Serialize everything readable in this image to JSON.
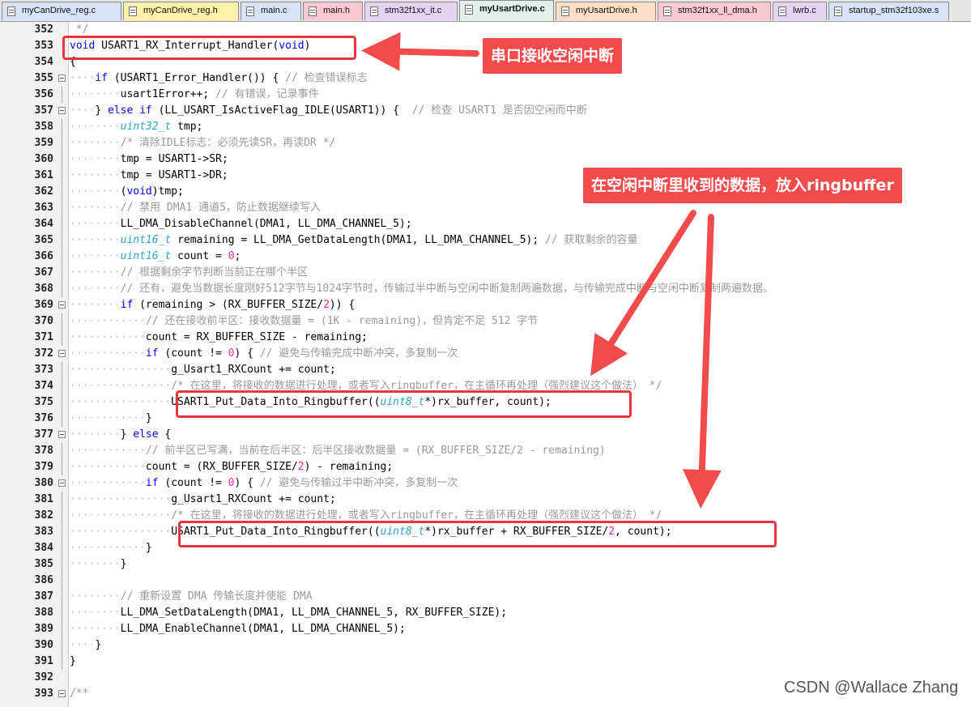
{
  "tabs": [
    {
      "label": "myCanDrive_reg.c",
      "bg": "#d7e2f7",
      "active": false
    },
    {
      "label": "myCanDrive_reg.h",
      "bg": "#fbf1a8",
      "active": false
    },
    {
      "label": "main.c",
      "bg": "#d7e2f7",
      "active": false
    },
    {
      "label": "main.h",
      "bg": "#f8c9d3",
      "active": false
    },
    {
      "label": "stm32f1xx_it.c",
      "bg": "#e2d4f2",
      "active": false
    },
    {
      "label": "myUsartDrive.c",
      "bg": "#d7ecdf",
      "active": true
    },
    {
      "label": "myUsartDrive.h",
      "bg": "#fbdcc5",
      "active": false
    },
    {
      "label": "stm32f1xx_ll_dma.h",
      "bg": "#f8c9d3",
      "active": false
    },
    {
      "label": "lwrb.c",
      "bg": "#e2d4f2",
      "active": false
    },
    {
      "label": "startup_stm32f103xe.s",
      "bg": "#d7e2f7",
      "active": false
    }
  ],
  "code_lines": [
    {
      "num": "352",
      "dots": "",
      "segs": [
        {
          "c": "c",
          "t": " */"
        }
      ]
    },
    {
      "num": "353",
      "dots": "",
      "segs": [
        {
          "c": "k",
          "t": "void"
        },
        {
          "c": "o",
          "t": " USART1_RX_Interrupt_Handler("
        },
        {
          "c": "k",
          "t": "void"
        },
        {
          "c": "o",
          "t": ")"
        }
      ]
    },
    {
      "num": "354",
      "dots": "",
      "segs": [
        {
          "c": "o",
          "t": "{"
        }
      ]
    },
    {
      "num": "355",
      "dots": "····",
      "segs": [
        {
          "c": "k",
          "t": "if"
        },
        {
          "c": "o",
          "t": " (USART1_Error_Handler()) { "
        },
        {
          "c": "c",
          "t": "// 检查错误标志"
        }
      ]
    },
    {
      "num": "356",
      "dots": "········",
      "segs": [
        {
          "c": "o",
          "t": "usart1Error++; "
        },
        {
          "c": "c",
          "t": "// 有错误，记录事件"
        }
      ]
    },
    {
      "num": "357",
      "dots": "····",
      "segs": [
        {
          "c": "o",
          "t": "} "
        },
        {
          "c": "k",
          "t": "else if"
        },
        {
          "c": "o",
          "t": " (LL_USART_IsActiveFlag_IDLE(USART1)) {  "
        },
        {
          "c": "c",
          "t": "// 检查 USART1 是否因空闲而中断"
        }
      ]
    },
    {
      "num": "358",
      "dots": "········",
      "segs": [
        {
          "c": "t",
          "t": "uint32_t"
        },
        {
          "c": "o",
          "t": " tmp;"
        }
      ]
    },
    {
      "num": "359",
      "dots": "········",
      "segs": [
        {
          "c": "c",
          "t": "/* 清除IDLE标志：必须先读SR，再读DR */"
        }
      ]
    },
    {
      "num": "360",
      "dots": "········",
      "segs": [
        {
          "c": "o",
          "t": "tmp = USART1->SR;"
        }
      ]
    },
    {
      "num": "361",
      "dots": "········",
      "segs": [
        {
          "c": "o",
          "t": "tmp = USART1->DR;"
        }
      ]
    },
    {
      "num": "362",
      "dots": "········",
      "segs": [
        {
          "c": "o",
          "t": "("
        },
        {
          "c": "k",
          "t": "void"
        },
        {
          "c": "o",
          "t": ")tmp;"
        }
      ]
    },
    {
      "num": "363",
      "dots": "········",
      "segs": [
        {
          "c": "c",
          "t": "// 禁用 DMA1 通道5，防止数据继续写入"
        }
      ]
    },
    {
      "num": "364",
      "dots": "········",
      "segs": [
        {
          "c": "o",
          "t": "LL_DMA_DisableChannel(DMA1, LL_DMA_CHANNEL_5);"
        }
      ]
    },
    {
      "num": "365",
      "dots": "········",
      "segs": [
        {
          "c": "t",
          "t": "uint16_t"
        },
        {
          "c": "o",
          "t": " remaining = LL_DMA_GetDataLength(DMA1, LL_DMA_CHANNEL_5); "
        },
        {
          "c": "c",
          "t": "// 获取剩余的容量"
        }
      ]
    },
    {
      "num": "366",
      "dots": "········",
      "segs": [
        {
          "c": "t",
          "t": "uint16_t"
        },
        {
          "c": "o",
          "t": " count = "
        },
        {
          "c": "n",
          "t": "0"
        },
        {
          "c": "o",
          "t": ";"
        }
      ]
    },
    {
      "num": "367",
      "dots": "········",
      "segs": [
        {
          "c": "c",
          "t": "// 根据剩余字节判断当前正在哪个半区"
        }
      ]
    },
    {
      "num": "368",
      "dots": "········",
      "segs": [
        {
          "c": "c",
          "t": "// 还有，避免当数据长度刚好512字节与1024字节时，传输过半中断与空闲中断复制两遍数据，与传输完成中断与空闲中断复制两遍数据。"
        }
      ]
    },
    {
      "num": "369",
      "dots": "········",
      "segs": [
        {
          "c": "k",
          "t": "if"
        },
        {
          "c": "o",
          "t": " (remaining > (RX_BUFFER_SIZE/"
        },
        {
          "c": "n",
          "t": "2"
        },
        {
          "c": "o",
          "t": ")) {"
        }
      ]
    },
    {
      "num": "370",
      "dots": "············",
      "segs": [
        {
          "c": "c",
          "t": "// 还在接收前半区：接收数据量 = (1K - remaining)，但肯定不足 512 字节"
        }
      ]
    },
    {
      "num": "371",
      "dots": "············",
      "segs": [
        {
          "c": "o",
          "t": "count = RX_BUFFER_SIZE - remaining;"
        }
      ]
    },
    {
      "num": "372",
      "dots": "············",
      "segs": [
        {
          "c": "k",
          "t": "if"
        },
        {
          "c": "o",
          "t": " (count != "
        },
        {
          "c": "n",
          "t": "0"
        },
        {
          "c": "o",
          "t": ") { "
        },
        {
          "c": "c",
          "t": "// 避免与传输完成中断冲突，多复制一次"
        }
      ]
    },
    {
      "num": "373",
      "dots": "················",
      "segs": [
        {
          "c": "o",
          "t": "g_Usart1_RXCount += count;"
        }
      ]
    },
    {
      "num": "374",
      "dots": "················",
      "segs": [
        {
          "c": "c",
          "t": "/* 在这里，将接收的数据进行处理，或者写入ringbuffer，在主循环再处理（强烈建议这个做法） */"
        }
      ]
    },
    {
      "num": "375",
      "dots": "················",
      "segs": [
        {
          "c": "o",
          "t": "USART1_Put_Data_Into_Ringbuffer(("
        },
        {
          "c": "t",
          "t": "uint8_t"
        },
        {
          "c": "o",
          "t": "*)rx_buffer, count);"
        }
      ]
    },
    {
      "num": "376",
      "dots": "············",
      "segs": [
        {
          "c": "o",
          "t": "}"
        }
      ]
    },
    {
      "num": "377",
      "dots": "········",
      "segs": [
        {
          "c": "o",
          "t": "} "
        },
        {
          "c": "k",
          "t": "else"
        },
        {
          "c": "o",
          "t": " {"
        }
      ]
    },
    {
      "num": "378",
      "dots": "············",
      "segs": [
        {
          "c": "c",
          "t": "// 前半区已写满，当前在后半区：后半区接收数据量 = (RX_BUFFER_SIZE/2 - remaining)"
        }
      ]
    },
    {
      "num": "379",
      "dots": "············",
      "segs": [
        {
          "c": "o",
          "t": "count = (RX_BUFFER_SIZE/"
        },
        {
          "c": "n",
          "t": "2"
        },
        {
          "c": "o",
          "t": ") - remaining;"
        }
      ]
    },
    {
      "num": "380",
      "dots": "············",
      "segs": [
        {
          "c": "k",
          "t": "if"
        },
        {
          "c": "o",
          "t": " (count != "
        },
        {
          "c": "n",
          "t": "0"
        },
        {
          "c": "o",
          "t": ") { "
        },
        {
          "c": "c",
          "t": "// 避免与传输过半中断冲突，多复制一次"
        }
      ]
    },
    {
      "num": "381",
      "dots": "················",
      "segs": [
        {
          "c": "o",
          "t": "g_Usart1_RXCount += count;"
        }
      ]
    },
    {
      "num": "382",
      "dots": "················",
      "segs": [
        {
          "c": "c",
          "t": "/* 在这里，将接收的数据进行处理，或者写入ringbuffer，在主循环再处理（强烈建议这个做法） */"
        }
      ]
    },
    {
      "num": "383",
      "dots": "················",
      "segs": [
        {
          "c": "o",
          "t": "USART1_Put_Data_Into_Ringbuffer(("
        },
        {
          "c": "t",
          "t": "uint8_t"
        },
        {
          "c": "o",
          "t": "*)rx_buffer + RX_BUFFER_SIZE/"
        },
        {
          "c": "n",
          "t": "2"
        },
        {
          "c": "o",
          "t": ", count);"
        }
      ]
    },
    {
      "num": "384",
      "dots": "············",
      "segs": [
        {
          "c": "o",
          "t": "}"
        }
      ]
    },
    {
      "num": "385",
      "dots": "········",
      "segs": [
        {
          "c": "o",
          "t": "}"
        }
      ]
    },
    {
      "num": "386",
      "dots": "",
      "segs": []
    },
    {
      "num": "387",
      "dots": "········",
      "segs": [
        {
          "c": "c",
          "t": "// 重新设置 DMA 传输长度并使能 DMA"
        }
      ]
    },
    {
      "num": "388",
      "dots": "········",
      "segs": [
        {
          "c": "o",
          "t": "LL_DMA_SetDataLength(DMA1, LL_DMA_CHANNEL_5, RX_BUFFER_SIZE);"
        }
      ]
    },
    {
      "num": "389",
      "dots": "········",
      "segs": [
        {
          "c": "o",
          "t": "LL_DMA_EnableChannel(DMA1, LL_DMA_CHANNEL_5);"
        }
      ]
    },
    {
      "num": "390",
      "dots": "····",
      "segs": [
        {
          "c": "o",
          "t": "}"
        }
      ]
    },
    {
      "num": "391",
      "dots": "",
      "segs": [
        {
          "c": "o",
          "t": "}"
        }
      ]
    },
    {
      "num": "392",
      "dots": "",
      "segs": []
    },
    {
      "num": "393",
      "dots": "",
      "segs": [
        {
          "c": "c",
          "t": "/**"
        }
      ]
    }
  ],
  "annotations": {
    "callout_idle": "串口接收空闲中断",
    "callout_ringbuffer": "在空闲中断里收到的数据，放入ringbuffer",
    "accent_color": "#f24b4b"
  },
  "watermark": "CSDN @Wallace Zhang"
}
